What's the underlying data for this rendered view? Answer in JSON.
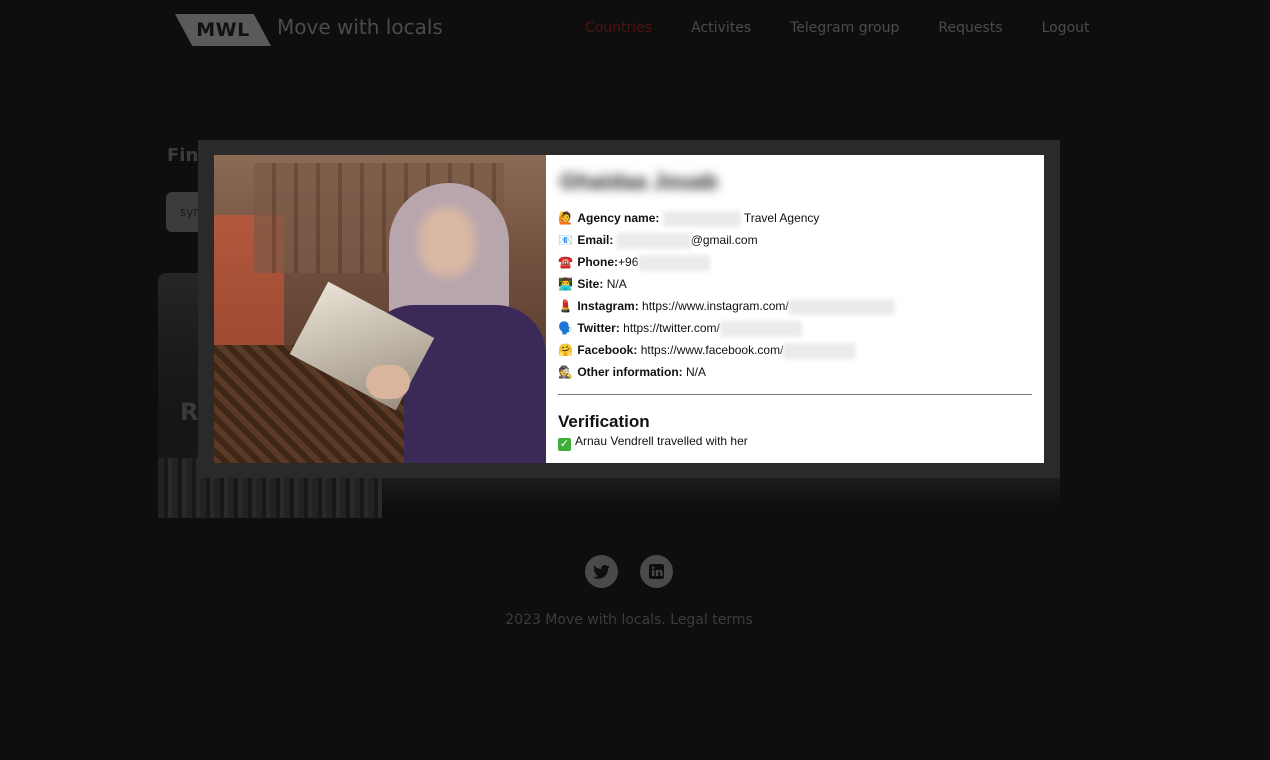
{
  "header": {
    "logo": "MWL",
    "brand": "Move with locals",
    "nav": [
      "Countries",
      "Activites",
      "Telegram group",
      "Requests",
      "Logout"
    ],
    "active_nav": "Countries"
  },
  "background_page": {
    "heading_partial": "Fin",
    "search_partial": "syr",
    "card_letter": "R"
  },
  "profile": {
    "name": "Ghaidaa Jouab",
    "rows": [
      {
        "emoji": "🙋",
        "label": "Agency name:",
        "value": "Travel Agency",
        "blur_before": true,
        "blur_after": false
      },
      {
        "emoji": "📧",
        "label": "Email:",
        "value": "@gmail.com",
        "blur_before": true,
        "blur_after": false
      },
      {
        "emoji": "☎️",
        "label": "Phone:",
        "value": "+96",
        "blur_before": false,
        "blur_after": true
      },
      {
        "emoji": "👨‍💻",
        "label": "Site:",
        "value": "N/A",
        "blur_before": false,
        "blur_after": false
      },
      {
        "emoji": "💄",
        "label": "Instagram:",
        "value": "https://www.instagram.com/",
        "blur_before": false,
        "blur_after": true
      },
      {
        "emoji": "🗣️",
        "label": "Twitter:",
        "value": "https://twitter.com/",
        "blur_before": false,
        "blur_after": true
      },
      {
        "emoji": "🤗",
        "label": "Facebook:",
        "value": "https://www.facebook.com/",
        "blur_before": false,
        "blur_after": true
      },
      {
        "emoji": "🕵️",
        "label": "Other information:",
        "value": "N/A",
        "blur_before": false,
        "blur_after": false
      }
    ],
    "verification_title": "Verification",
    "verification_text": "Arnau Vendrell travelled with her"
  },
  "footer": {
    "twitter_icon": "twitter-icon",
    "linkedin_icon": "linkedin-icon",
    "copyright": "2023 Move with locals. Legal terms"
  }
}
